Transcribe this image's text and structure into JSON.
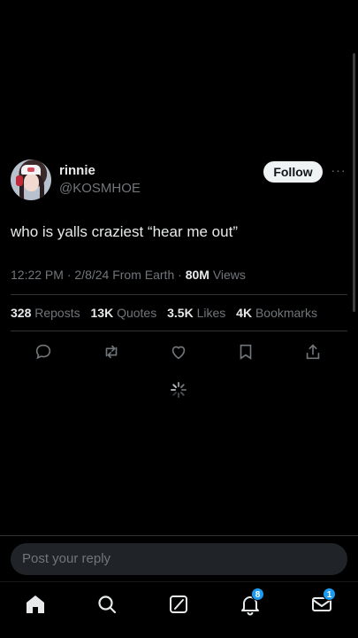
{
  "author": {
    "display_name": "rinnie",
    "handle": "@KOSMHOE",
    "follow_label": "Follow",
    "more_label": "···"
  },
  "tweet": {
    "text": "who is yalls craziest “hear me out”",
    "time": "12:22 PM",
    "date": "2/8/24",
    "source": "From Earth",
    "views_count": "80M",
    "views_label": "Views"
  },
  "stats": [
    {
      "count": "328",
      "label": "Reposts"
    },
    {
      "count": "13K",
      "label": "Quotes"
    },
    {
      "count": "3.5K",
      "label": "Likes"
    },
    {
      "count": "4K",
      "label": "Bookmarks"
    }
  ],
  "actions": [
    "reply-icon",
    "repost-icon",
    "like-icon",
    "bookmark-icon",
    "share-icon"
  ],
  "reply_bar": {
    "placeholder": "Post your reply"
  },
  "bottom_nav": {
    "items": [
      "home-icon",
      "search-icon",
      "grok-icon",
      "notifications-icon",
      "messages-icon"
    ],
    "notifications_badge": "8",
    "messages_badge": "1"
  },
  "colors": {
    "background": "#000000",
    "text": "#e7e9ea",
    "muted": "#71767b",
    "accent": "#1d9bf0"
  }
}
